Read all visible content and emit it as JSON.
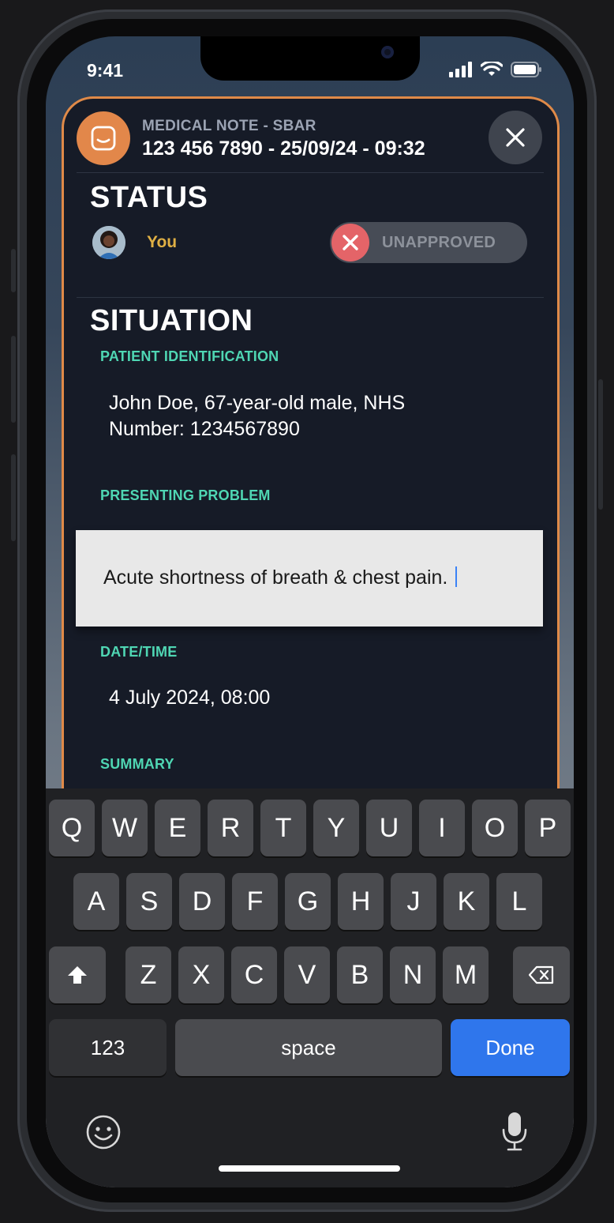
{
  "status_bar": {
    "time": "9:41"
  },
  "note": {
    "kicker": "MEDICAL NOTE - SBAR",
    "title": "123 456 7890 - 25/09/24 - 09:32"
  },
  "status_section": {
    "heading": "STATUS",
    "user_label": "You",
    "approval_label": "UNAPPROVED",
    "approval_state": "unapproved"
  },
  "situation": {
    "heading": "SITUATION",
    "fields": [
      {
        "label": "PATIENT IDENTIFICATION",
        "value_lines": [
          "John Doe, 67-year-old male, NHS",
          "Number: 1234567890"
        ]
      },
      {
        "label": "PRESENTING PROBLEM",
        "value": "Acute shortness of breath & chest pain."
      },
      {
        "label": "DATE/TIME",
        "value": "4 July 2024, 08:00"
      },
      {
        "label": "SUMMARY",
        "value": ""
      }
    ]
  },
  "keyboard": {
    "row1": [
      "Q",
      "W",
      "E",
      "R",
      "T",
      "Y",
      "U",
      "I",
      "O",
      "P"
    ],
    "row2": [
      "A",
      "S",
      "D",
      "F",
      "G",
      "H",
      "J",
      "K",
      "L"
    ],
    "row3": [
      "Z",
      "X",
      "C",
      "V",
      "B",
      "N",
      "M"
    ],
    "numbers_label": "123",
    "space_label": "space",
    "done_label": "Done"
  },
  "colors": {
    "accent_orange": "#e2874a",
    "label_teal": "#4fd6b3",
    "user_gold": "#e0b044",
    "reject_red": "#e46468",
    "done_blue": "#2f76ec"
  }
}
